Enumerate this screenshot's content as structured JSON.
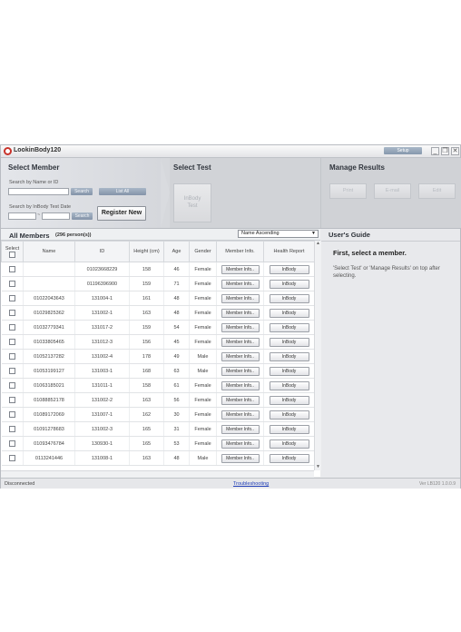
{
  "app": {
    "title": "LookinBody120",
    "setup_label": "Setup",
    "win_min": "_",
    "win_restore": "❐",
    "win_close": "✕"
  },
  "select_member": {
    "header": "Select Member",
    "search_name_label": "Search by Name or ID",
    "search_name_value": "",
    "search_button": "Search",
    "list_all_button": "List All",
    "search_date_label": "Search by InBody Test Date",
    "date_from": "",
    "date_sep": "~",
    "date_to": "",
    "search_date_button": "Search",
    "register_button": "Register New"
  },
  "select_test": {
    "header": "Select Test",
    "inbody_test_line1": "InBody",
    "inbody_test_line2": "Test"
  },
  "manage_results": {
    "header": "Manage Results",
    "print_button": "Print",
    "email_button": "E-mail",
    "edit_button": "Edit"
  },
  "members": {
    "title": "All Members",
    "count": "(296 person(s))",
    "sort_value": "Name Ascending",
    "columns": [
      "Select",
      "Name",
      "ID",
      "Height (cm)",
      "Age",
      "Gender",
      "Member Info.",
      "Health Report"
    ],
    "member_info_btn": "Member Info..",
    "inbody_btn": "InBody",
    "rows": [
      {
        "name": "",
        "id": "01023668229",
        "height": "158",
        "age": "46",
        "gender": "Female"
      },
      {
        "name": "",
        "id": "01196396900",
        "height": "159",
        "age": "71",
        "gender": "Female"
      },
      {
        "name": "01022043643",
        "id": "131004-1",
        "height": "161",
        "age": "48",
        "gender": "Female"
      },
      {
        "name": "01029825362",
        "id": "131002-1",
        "height": "163",
        "age": "48",
        "gender": "Female"
      },
      {
        "name": "01032779341",
        "id": "131017-2",
        "height": "159",
        "age": "54",
        "gender": "Female"
      },
      {
        "name": "01033805465",
        "id": "131012-3",
        "height": "156",
        "age": "45",
        "gender": "Female"
      },
      {
        "name": "01052137282",
        "id": "131002-4",
        "height": "178",
        "age": "49",
        "gender": "Male"
      },
      {
        "name": "01053199127",
        "id": "131003-1",
        "height": "168",
        "age": "63",
        "gender": "Male"
      },
      {
        "name": "01063185021",
        "id": "131011-1",
        "height": "158",
        "age": "61",
        "gender": "Female"
      },
      {
        "name": "01088852178",
        "id": "131002-2",
        "height": "163",
        "age": "56",
        "gender": "Female"
      },
      {
        "name": "01089172069",
        "id": "131007-1",
        "height": "162",
        "age": "30",
        "gender": "Female"
      },
      {
        "name": "01091278683",
        "id": "131002-3",
        "height": "165",
        "age": "31",
        "gender": "Female"
      },
      {
        "name": "01093476784",
        "id": "130930-1",
        "height": "165",
        "age": "53",
        "gender": "Female"
      },
      {
        "name": "0113241446",
        "id": "131008-1",
        "height": "163",
        "age": "48",
        "gender": "Male"
      }
    ]
  },
  "guide": {
    "title": "User's Guide",
    "heading": "First, select a member.",
    "body": "'Select Test' or 'Manage Results' on top after selecting."
  },
  "status": {
    "left": "Disconnected",
    "link": "Troubleshooting",
    "version": "Ver LB120 1.0.0.9"
  },
  "colors": {
    "brand_red": "#c8332b",
    "accent_blue": "#8494a9",
    "link_blue": "#2340b8"
  }
}
